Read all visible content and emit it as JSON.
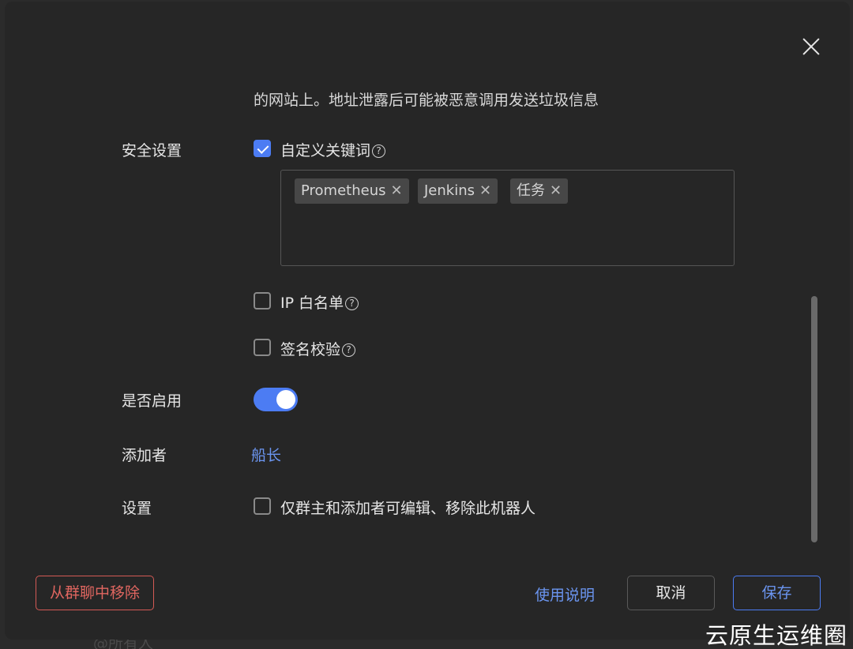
{
  "backdrop": {
    "partial_text": "@所有人"
  },
  "dialog": {
    "description_tail": "的网站上。地址泄露后可能被恶意调用发送垃圾信息",
    "security": {
      "label": "安全设置",
      "custom_keywords": {
        "label": "自定义关键词",
        "checked": true
      },
      "keywords": [
        "Prometheus",
        "Jenkins",
        "任务"
      ],
      "ip_whitelist": {
        "label": "IP 白名单",
        "checked": false
      },
      "signature": {
        "label": "签名校验",
        "checked": false
      }
    },
    "enabled": {
      "label": "是否启用",
      "on": true
    },
    "adder": {
      "label": "添加者",
      "value": "船长"
    },
    "settings": {
      "label": "设置",
      "option": "仅群主和添加者可编辑、移除此机器人",
      "checked": false
    },
    "footer": {
      "remove_label": "从群聊中移除",
      "help_label": "使用说明",
      "cancel_label": "取消",
      "save_label": "保存"
    }
  },
  "icons": {
    "close": "close-icon",
    "help": "question-circle-icon",
    "tag_remove": "x-icon"
  },
  "colors": {
    "accent": "#4c7cf3",
    "danger": "#e06660",
    "background": "#262626"
  },
  "watermark": "云原生运维圈"
}
